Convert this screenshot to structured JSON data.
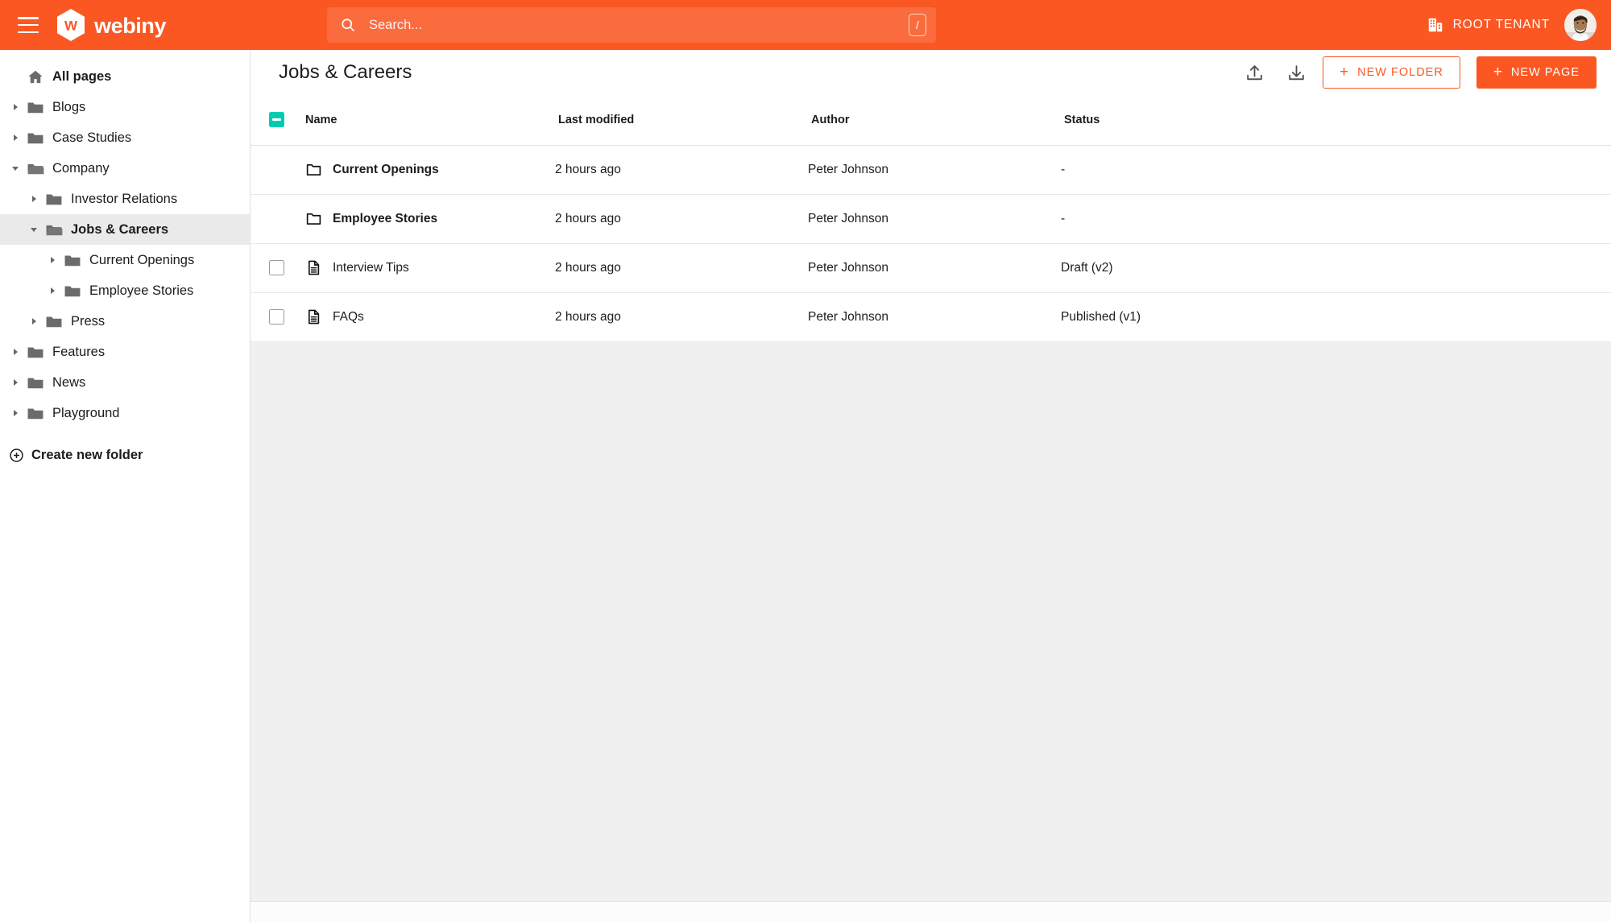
{
  "topbar": {
    "menu_icon": "hamburger-menu-icon",
    "brand_name": "webiny",
    "brand_mark": "webiny-hexagon-logo",
    "search": {
      "icon": "search-icon",
      "placeholder": "Search...",
      "value": "",
      "shortcut_key": "/"
    },
    "tenant": {
      "icon": "building-icon",
      "label": "ROOT TENANT"
    },
    "avatar": "user-avatar",
    "background_color": "#fa5723"
  },
  "sidebar": {
    "items": [
      {
        "label": "All pages",
        "indent": 0,
        "icon": "home-icon",
        "caret": "none",
        "bold": true,
        "active": false
      },
      {
        "label": "Blogs",
        "indent": 0,
        "icon": "folder-icon",
        "caret": "closed",
        "bold": false,
        "active": false
      },
      {
        "label": "Case Studies",
        "indent": 0,
        "icon": "folder-icon",
        "caret": "closed",
        "bold": false,
        "active": false
      },
      {
        "label": "Company",
        "indent": 0,
        "icon": "folder-open-icon",
        "caret": "open",
        "bold": false,
        "active": false
      },
      {
        "label": "Investor Relations",
        "indent": 1,
        "icon": "folder-icon",
        "caret": "closed",
        "bold": false,
        "active": false
      },
      {
        "label": "Jobs & Careers",
        "indent": 1,
        "icon": "folder-open-icon",
        "caret": "open",
        "bold": true,
        "active": true
      },
      {
        "label": "Current Openings",
        "indent": 2,
        "icon": "folder-icon",
        "caret": "closed",
        "bold": false,
        "active": false
      },
      {
        "label": "Employee Stories",
        "indent": 2,
        "icon": "folder-icon",
        "caret": "closed",
        "bold": false,
        "active": false
      },
      {
        "label": "Press",
        "indent": 1,
        "icon": "folder-icon",
        "caret": "closed",
        "bold": false,
        "active": false
      },
      {
        "label": "Features",
        "indent": 0,
        "icon": "folder-icon",
        "caret": "closed",
        "bold": false,
        "active": false
      },
      {
        "label": "News",
        "indent": 0,
        "icon": "folder-icon",
        "caret": "closed",
        "bold": false,
        "active": false
      },
      {
        "label": "Playground",
        "indent": 0,
        "icon": "folder-icon",
        "caret": "closed",
        "bold": false,
        "active": false
      }
    ],
    "create_folder": {
      "icon": "plus-circle-icon",
      "label": "Create new folder"
    }
  },
  "header": {
    "title": "Jobs & Careers",
    "upload_icon": "upload-icon",
    "download_icon": "download-icon",
    "new_folder_label": "NEW FOLDER",
    "new_page_label": "NEW PAGE",
    "plus": "+",
    "accent_color": "#fa5723"
  },
  "table": {
    "select_all_state": "indeterminate",
    "select_all_color": "#00ccb2",
    "columns": [
      "Name",
      "Last modified",
      "Author",
      "Status"
    ],
    "rows": [
      {
        "type": "folder",
        "icon": "folder-icon",
        "name": "Current Openings",
        "modified": "2 hours ago",
        "author": "Peter Johnson",
        "status": "-",
        "checkbox": false,
        "menu_icon": "more-vertical-icon"
      },
      {
        "type": "folder",
        "icon": "folder-icon",
        "name": "Employee Stories",
        "modified": "2 hours ago",
        "author": "Peter Johnson",
        "status": "-",
        "checkbox": false,
        "menu_icon": "more-vertical-icon"
      },
      {
        "type": "page",
        "icon": "document-icon",
        "name": "Interview Tips",
        "modified": "2 hours ago",
        "author": "Peter Johnson",
        "status": "Draft (v2)",
        "checkbox": true,
        "menu_icon": "more-vertical-icon"
      },
      {
        "type": "page",
        "icon": "document-icon",
        "name": "FAQs",
        "modified": "2 hours ago",
        "author": "Peter Johnson",
        "status": "Published (v1)",
        "checkbox": true,
        "menu_icon": "more-vertical-icon"
      }
    ]
  }
}
